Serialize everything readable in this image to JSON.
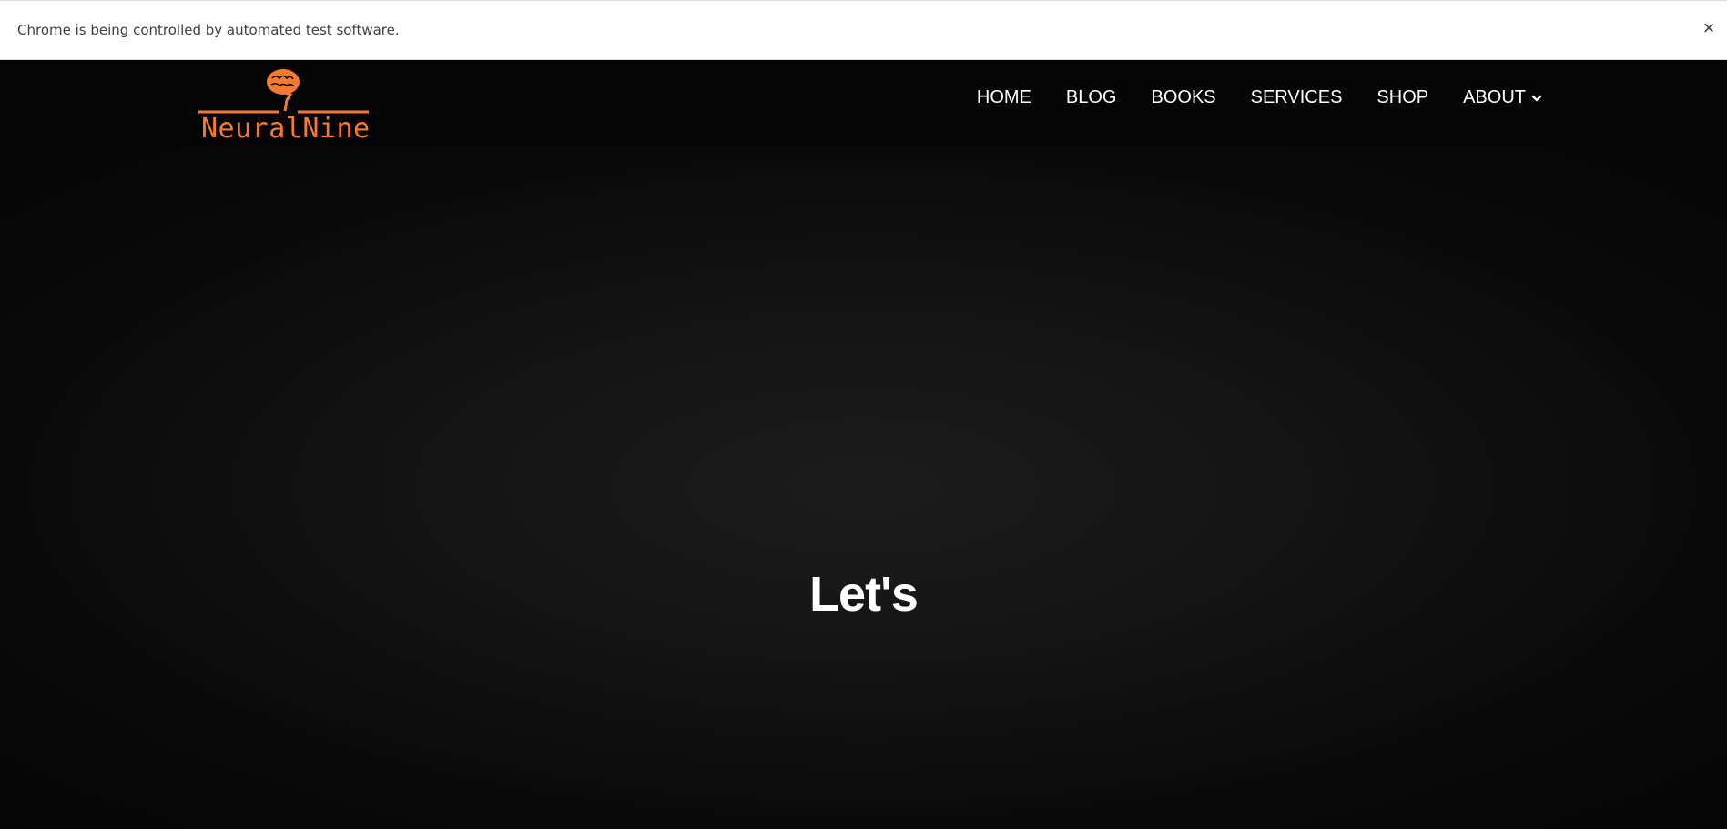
{
  "infobar": {
    "message": "Chrome is being controlled by automated test software.",
    "close_icon": "×"
  },
  "header": {
    "logo_text": "NeuralNine",
    "logo_icon": "brain-icon",
    "brand_color": "#f47a30",
    "nav": [
      {
        "label": "HOME"
      },
      {
        "label": "BLOG"
      },
      {
        "label": "BOOKS"
      },
      {
        "label": "SERVICES"
      },
      {
        "label": "SHOP"
      },
      {
        "label": "ABOUT",
        "has_dropdown": true
      }
    ]
  },
  "hero": {
    "title": "Let's"
  }
}
